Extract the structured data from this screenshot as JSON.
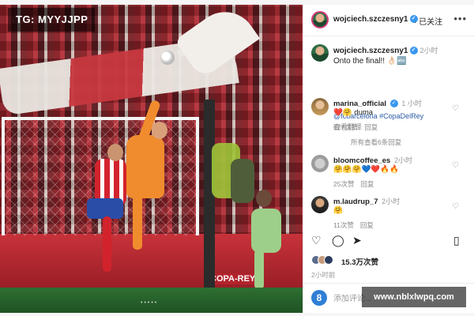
{
  "overlay": {
    "tg_label": "TG: MYYJJPP",
    "watermark": "www.nblxlwpq.com"
  },
  "photo": {
    "board_text": "COPA-REY",
    "carousel_dots": "•••••"
  },
  "header": {
    "username": "wojciech.szczesny1",
    "follow_label": "· 已关注",
    "more_label": "•••"
  },
  "post": {
    "username": "wojciech.szczesny1",
    "time": "2小时",
    "text": "Onto the final!!",
    "text_emoji": "👌🏻🔤",
    "tags": "@fcbarcelona #CopaDelRey",
    "translate": "查看翻译"
  },
  "comments": [
    {
      "username": "marina_official",
      "time": "1 小时",
      "text": "❤️🤗 duma",
      "likes": "627次赞",
      "reply": "回复"
    },
    {
      "username": "bloomcoffee_es",
      "time": "2小时",
      "text": "🤗🤗🤗💙❤️🔥🔥",
      "likes": "25次赞",
      "reply": "回复"
    },
    {
      "username": "m.laudrup_7",
      "time": "2小时",
      "text": "🤗",
      "likes": "11次赞",
      "reply": "回复"
    }
  ],
  "view_all_replies": "所有查看6条回复",
  "actions": {
    "like_icon": "heart-icon",
    "comment_icon": "comment-icon",
    "share_icon": "send-icon",
    "save_icon": "bookmark-icon"
  },
  "likes_text": "15.3万次赞",
  "post_time": "2小时前",
  "comment_placeholder": "添加评论...",
  "colors": {
    "verified": "#3897f0",
    "link": "#2a5aa5",
    "keeper_kit": "#f08c2e",
    "atletico_red": "#d2232d"
  }
}
